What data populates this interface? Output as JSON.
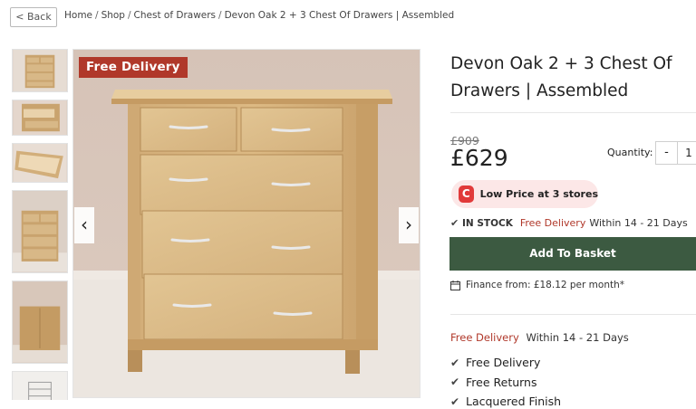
{
  "nav": {
    "back_label": "< Back",
    "breadcrumb": [
      "Home",
      "Shop",
      "Chest of Drawers",
      "Devon Oak 2 + 3 Chest Of Drawers | Assembled"
    ],
    "separator": "/"
  },
  "gallery": {
    "badge": "Free Delivery",
    "prev_arrow": "‹",
    "next_arrow": "›",
    "thumbnail_count": 6
  },
  "product": {
    "title": "Devon Oak 2 + 3 Chest Of Drawers | Assembled",
    "old_price": "£909",
    "price": "£629",
    "quantity_label": "Quantity:",
    "quantity_minus": "-",
    "quantity_value": "1",
    "low_price_icon": "C",
    "low_price_text": "Low Price at 3 stores",
    "stock_status": "IN STOCK",
    "stock_delivery_label": "Free Delivery",
    "stock_delivery_window": "Within 14 - 21 Days",
    "basket_label": "Add To Basket",
    "finance_text": "Finance from: £18.12 per month*",
    "delivery_label": "Free Delivery",
    "delivery_window": "Within 14 - 21 Days",
    "features": [
      "Free Delivery",
      "Free Returns",
      "Lacquered Finish"
    ]
  },
  "colors": {
    "accent_red": "#b0382a",
    "basket_green": "#3c5a41",
    "low_price_bg": "#fce7e7",
    "low_price_icon": "#e13a3a"
  }
}
